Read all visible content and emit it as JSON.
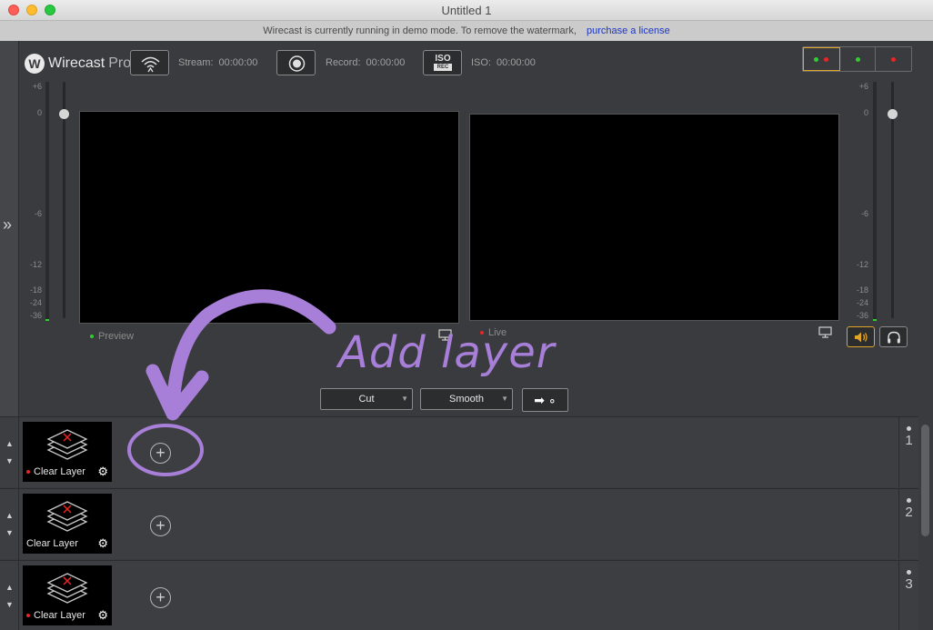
{
  "window": {
    "title": "Untitled 1"
  },
  "banner": {
    "message": "Wirecast is currently running in demo mode. To remove the watermark,",
    "link": "purchase a license"
  },
  "logo": {
    "name": "Wirecast",
    "edition": "Pro",
    "mark": "W"
  },
  "toolbar": {
    "stream": {
      "label": "Stream:",
      "time": "00:00:00"
    },
    "record": {
      "label": "Record:",
      "time": "00:00:00"
    },
    "iso": {
      "label": "ISO:",
      "time": "00:00:00",
      "badge_top": "ISO",
      "badge_bottom": "REC"
    }
  },
  "meters": {
    "left_ticks": [
      "+6",
      "0",
      "-6",
      "-12",
      "-18",
      "-24",
      "-36"
    ],
    "right_ticks": [
      "+6",
      "0",
      "-6",
      "-12",
      "-18",
      "-24",
      "-36"
    ]
  },
  "monitors": {
    "preview_label": "Preview",
    "live_label": "Live"
  },
  "transition": {
    "cut_label": "Cut",
    "smooth_label": "Smooth",
    "go_symbol": "➡ ∘"
  },
  "annotation": {
    "text": "Add layer"
  },
  "layers": [
    {
      "number": "1",
      "shot_name": "Clear Layer",
      "live": true
    },
    {
      "number": "2",
      "shot_name": "Clear Layer",
      "live": false
    },
    {
      "number": "3",
      "shot_name": "Clear Layer",
      "live": true
    }
  ],
  "colors": {
    "accent": "#e0a528",
    "annotation": "#a87fd8",
    "live_red": "#e92525",
    "preview_green": "#2ed02e"
  }
}
